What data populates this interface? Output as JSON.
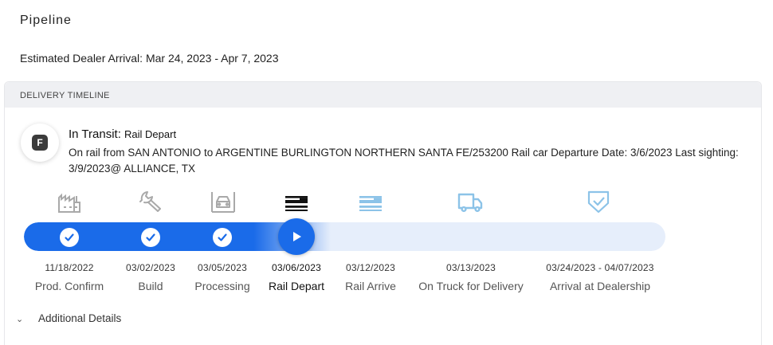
{
  "page": {
    "title": "Pipeline"
  },
  "eta": {
    "text": "Estimated Dealer Arrival: Mar 24, 2023 - Apr 7, 2023"
  },
  "timeline": {
    "header": "DELIVERY TIMELINE",
    "badge": "F",
    "status_main": "In Transit:",
    "status_sub": "Rail Depart",
    "detail": "On rail from SAN ANTONIO to ARGENTINE BURLINGTON NORTHERN SANTA FE/253200 Rail car Departure Date: 3/6/2023 Last sighting: 3/9/2023@ ALLIANCE, TX",
    "progress_stages_completed": 3,
    "current_stage": "Rail Depart",
    "colors": {
      "accent": "#1a6be9",
      "track": "#e6eefb",
      "complete_icon": "#a9a9a9",
      "current_icon": "#111111",
      "future_icon": "#8cc3e8"
    },
    "stages": [
      {
        "date": "11/18/2022",
        "label": "Prod. Confirm",
        "icon": "factory-icon",
        "state": "complete"
      },
      {
        "date": "03/02/2023",
        "label": "Build",
        "icon": "wrench-icon",
        "state": "complete"
      },
      {
        "date": "03/05/2023",
        "label": "Processing",
        "icon": "car-processing-icon",
        "state": "complete"
      },
      {
        "date": "03/06/2023",
        "label": "Rail Depart",
        "icon": "train-depart-icon",
        "state": "current"
      },
      {
        "date": "03/12/2023",
        "label": "Rail Arrive",
        "icon": "train-arrive-icon",
        "state": "future"
      },
      {
        "date": "03/13/2023",
        "label": "On Truck for Delivery",
        "icon": "truck-icon",
        "state": "future"
      },
      {
        "date": "03/24/2023 - 04/07/2023",
        "label": "Arrival at Dealership",
        "icon": "shield-check-icon",
        "state": "future"
      }
    ]
  },
  "additional_details": {
    "label": "Additional Details",
    "icon": "chevron-down-icon"
  }
}
